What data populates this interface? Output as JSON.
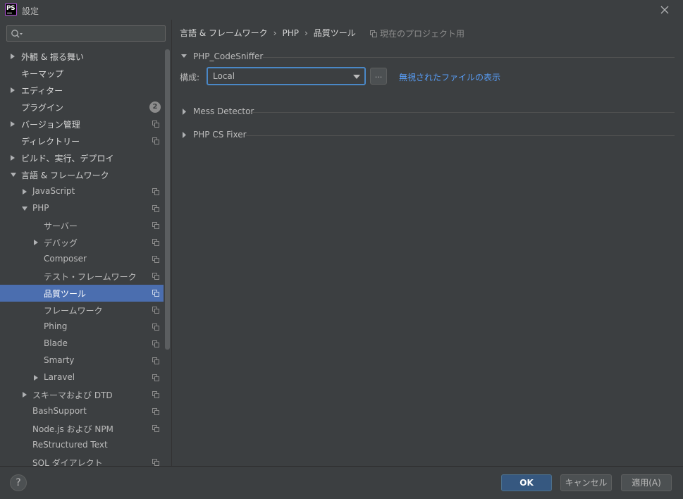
{
  "window": {
    "title": "設定",
    "app_icon_text": "PS",
    "icon": "close-icon"
  },
  "sidebar": {
    "search": {
      "value": "",
      "placeholder": "",
      "icon": "search-icon"
    },
    "plugins_badge": "2",
    "items": [
      {
        "label": "外観 & 振る舞い"
      },
      {
        "label": "キーマップ"
      },
      {
        "label": "エディター"
      },
      {
        "label": "プラグイン"
      },
      {
        "label": "バージョン管理"
      },
      {
        "label": "ディレクトリー"
      },
      {
        "label": "ビルド、実行、デプロイ"
      },
      {
        "label": "言語 & フレームワーク"
      },
      {
        "label": "JavaScript"
      },
      {
        "label": "PHP"
      },
      {
        "label": "サーバー"
      },
      {
        "label": "デバッグ"
      },
      {
        "label": "Composer"
      },
      {
        "label": "テスト・フレームワーク"
      },
      {
        "label": "品質ツール"
      },
      {
        "label": "フレームワーク"
      },
      {
        "label": "Phing"
      },
      {
        "label": "Blade"
      },
      {
        "label": "Smarty"
      },
      {
        "label": "Laravel"
      },
      {
        "label": "スキーマおよび DTD"
      },
      {
        "label": "BashSupport"
      },
      {
        "label": "Node.js および NPM"
      },
      {
        "label": "ReStructured Text"
      },
      {
        "label": "SQL ダイアレクト"
      }
    ]
  },
  "main": {
    "breadcrumb": [
      "言語 & フレームワーク",
      "PHP",
      "品質ツール"
    ],
    "breadcrumb_sep": "›",
    "project_note": "現在のプロジェクト用",
    "sections": {
      "codesniffer": "PHP_CodeSniffer",
      "mess_detector": "Mess Detector",
      "cs_fixer": "PHP CS Fixer"
    },
    "config_label": "構成:",
    "config_value": "Local",
    "dots_label": "...",
    "ignored_files_link": "無視されたファイルの表示"
  },
  "footer": {
    "help_label": "?",
    "ok_label": "OK",
    "cancel_label": "キャンセル",
    "apply_label": "適用(A)"
  },
  "colors": {
    "background": "#3c3f41",
    "selection": "#4b6eaf",
    "link": "#589df6",
    "ok_button": "#365880",
    "focus_border": "#4a88c7"
  }
}
